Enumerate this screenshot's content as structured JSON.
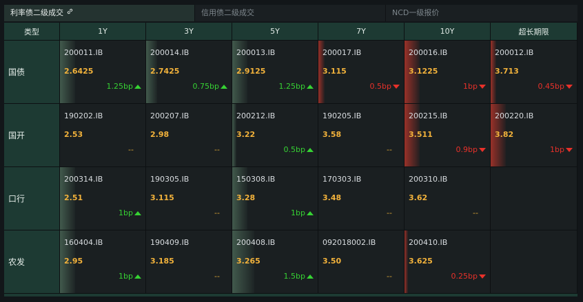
{
  "tabs": [
    {
      "label": "利率债二级成交",
      "active": true,
      "icon": "link-icon"
    },
    {
      "label": "信用债二级成交",
      "active": false
    },
    {
      "label": "NCD一级报价",
      "active": false
    }
  ],
  "colors": {
    "header_bg": "#1d3a33",
    "yield": "#f2b23b",
    "up": "#36d233",
    "down": "#e8312a",
    "flat": "#d9a436"
  },
  "table": {
    "type_header": "类型",
    "columns": [
      "1Y",
      "3Y",
      "5Y",
      "7Y",
      "10Y",
      "超长期限"
    ],
    "rows": [
      {
        "type": "国债",
        "cells": [
          {
            "code": "200011.IB",
            "yield": "2.6425",
            "change": "1.25bp",
            "dir": "up"
          },
          {
            "code": "200014.IB",
            "yield": "2.7425",
            "change": "0.75bp",
            "dir": "up"
          },
          {
            "code": "200013.IB",
            "yield": "2.9125",
            "change": "1.25bp",
            "dir": "up"
          },
          {
            "code": "200017.IB",
            "yield": "3.115",
            "change": "0.5bp",
            "dir": "down"
          },
          {
            "code": "200016.IB",
            "yield": "3.1225",
            "change": "1bp",
            "dir": "down"
          },
          {
            "code": "200012.IB",
            "yield": "3.713",
            "change": "0.45bp",
            "dir": "down"
          }
        ]
      },
      {
        "type": "国开",
        "cells": [
          {
            "code": "190202.IB",
            "yield": "2.53",
            "change": "--",
            "dir": "flat"
          },
          {
            "code": "200207.IB",
            "yield": "2.98",
            "change": "--",
            "dir": "flat"
          },
          {
            "code": "200212.IB",
            "yield": "3.22",
            "change": "0.5bp",
            "dir": "up"
          },
          {
            "code": "190205.IB",
            "yield": "3.58",
            "change": "--",
            "dir": "flat"
          },
          {
            "code": "200215.IB",
            "yield": "3.511",
            "change": "0.9bp",
            "dir": "down"
          },
          {
            "code": "200220.IB",
            "yield": "3.82",
            "change": "1bp",
            "dir": "down"
          }
        ]
      },
      {
        "type": "口行",
        "cells": [
          {
            "code": "200314.IB",
            "yield": "2.51",
            "change": "1bp",
            "dir": "up"
          },
          {
            "code": "190305.IB",
            "yield": "3.115",
            "change": "--",
            "dir": "flat"
          },
          {
            "code": "150308.IB",
            "yield": "3.28",
            "change": "1bp",
            "dir": "up"
          },
          {
            "code": "170303.IB",
            "yield": "3.48",
            "change": "--",
            "dir": "flat"
          },
          {
            "code": "200310.IB",
            "yield": "3.62",
            "change": "--",
            "dir": "flat"
          },
          null
        ]
      },
      {
        "type": "农发",
        "cells": [
          {
            "code": "160404.IB",
            "yield": "2.95",
            "change": "1bp",
            "dir": "up"
          },
          {
            "code": "190409.IB",
            "yield": "3.185",
            "change": "--",
            "dir": "flat"
          },
          {
            "code": "200408.IB",
            "yield": "3.265",
            "change": "1.5bp",
            "dir": "up"
          },
          {
            "code": "092018002.IB",
            "yield": "3.50",
            "change": "--",
            "dir": "flat"
          },
          {
            "code": "200410.IB",
            "yield": "3.625",
            "change": "0.25bp",
            "dir": "down"
          },
          null
        ]
      }
    ]
  }
}
